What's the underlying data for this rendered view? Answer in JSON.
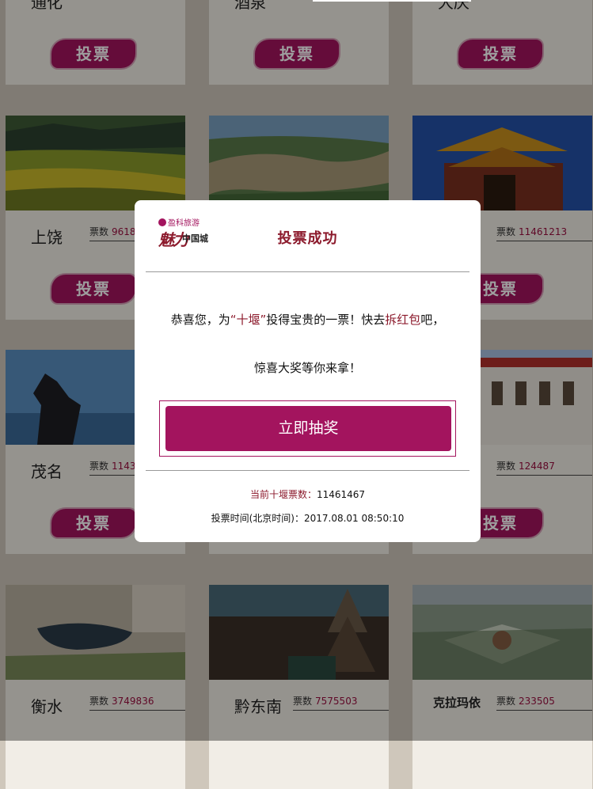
{
  "grid": {
    "vote_label": "投票",
    "votes_label": "票数",
    "top_row": [
      "通化",
      "酒泉",
      "大庆"
    ],
    "rows": [
      [
        {
          "name": "上饶",
          "votes": "9618"
        },
        {
          "name": "",
          "votes": ""
        },
        {
          "name": "",
          "votes": "11461213"
        }
      ],
      [
        {
          "name": "茂名",
          "votes": "1143"
        },
        {
          "name": "",
          "votes": ""
        },
        {
          "name": "",
          "votes": "124487"
        }
      ],
      [
        {
          "name": "衡水",
          "votes": "3749836"
        },
        {
          "name": "黔东南",
          "votes": "7575503"
        },
        {
          "name": "克拉玛依",
          "votes": "233505"
        }
      ]
    ]
  },
  "modal": {
    "logo_brand": "盈科旅游",
    "logo_calligraphy": "魅力",
    "logo_sub": "中国城",
    "title": "投票成功",
    "msg_prefix": "恭喜您，为",
    "msg_city": "“十堰”",
    "msg_mid": "投得宝贵的一票！快去",
    "msg_link": "拆红包",
    "msg_suffix": "吧，",
    "msg_line2": "惊喜大奖等你来拿！",
    "draw_button": "立即抽奖",
    "count_label": "当前十堰票数：",
    "count_value": "11461467",
    "time_label": "投票时间(北京时间)：",
    "time_value": "2017.08.01 08:50:10"
  },
  "colors": {
    "accent": "#a3145e",
    "title": "#8c1a2c"
  }
}
